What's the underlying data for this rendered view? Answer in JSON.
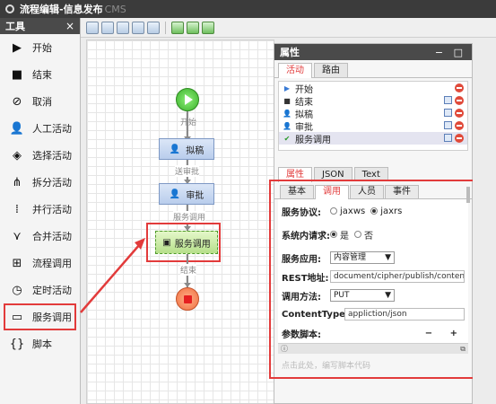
{
  "window": {
    "title": "流程编辑-信息发布",
    "subtitle": "CMS"
  },
  "tools": {
    "header": "工具",
    "close": "×",
    "items": [
      {
        "label": "开始",
        "icon": "play-icon"
      },
      {
        "label": "结束",
        "icon": "stop-icon"
      },
      {
        "label": "取消",
        "icon": "cancel-icon"
      },
      {
        "label": "人工活动",
        "icon": "person-icon"
      },
      {
        "label": "选择活动",
        "icon": "choice-icon"
      },
      {
        "label": "拆分活动",
        "icon": "split-icon"
      },
      {
        "label": "并行活动",
        "icon": "parallel-icon"
      },
      {
        "label": "合并活动",
        "icon": "merge-icon"
      },
      {
        "label": "流程调用",
        "icon": "subprocess-icon"
      },
      {
        "label": "定时活动",
        "icon": "clock-icon"
      },
      {
        "label": "服务调用",
        "icon": "service-icon"
      },
      {
        "label": "脚本",
        "icon": "script-icon"
      }
    ],
    "selected_index": 10
  },
  "canvas": {
    "edges": [
      "开始",
      "送审批",
      "服务调用",
      "结束"
    ],
    "nodes": {
      "draft": "拟稿",
      "approve": "审批",
      "service": "服务调用"
    }
  },
  "props": {
    "header": "属性",
    "controls": "− □",
    "tabs": [
      "活动",
      "路由"
    ],
    "activities": [
      {
        "label": "开始",
        "icon": "start-small-icon"
      },
      {
        "label": "结束",
        "icon": "end-small-icon"
      },
      {
        "label": "拟稿",
        "icon": "person-small-icon"
      },
      {
        "label": "审批",
        "icon": "person-small-icon"
      },
      {
        "label": "服务调用",
        "icon": "service-small-icon"
      }
    ],
    "tabs2": [
      "属性",
      "JSON",
      "Text"
    ],
    "subtabs": [
      "基本",
      "调用",
      "人员",
      "事件"
    ],
    "form": {
      "protocol_label": "服务协议:",
      "protocol_options": [
        "jaxws",
        "jaxrs"
      ],
      "protocol_selected": "jaxrs",
      "internal_label": "系统内请求:",
      "internal_options": [
        "是",
        "否"
      ],
      "internal_selected": "是",
      "app_label": "服务应用:",
      "app_value": "内容管理",
      "rest_label": "REST地址:",
      "rest_value": "document/cipher/publish/conten",
      "method_label": "调用方法:",
      "method_value": "PUT",
      "ctype_label": "ContentType:",
      "ctype_value": "appliction/json",
      "script_label": "参数脚本:",
      "script_controls": "− +"
    },
    "hint": "点击此处，编写脚本代码"
  }
}
